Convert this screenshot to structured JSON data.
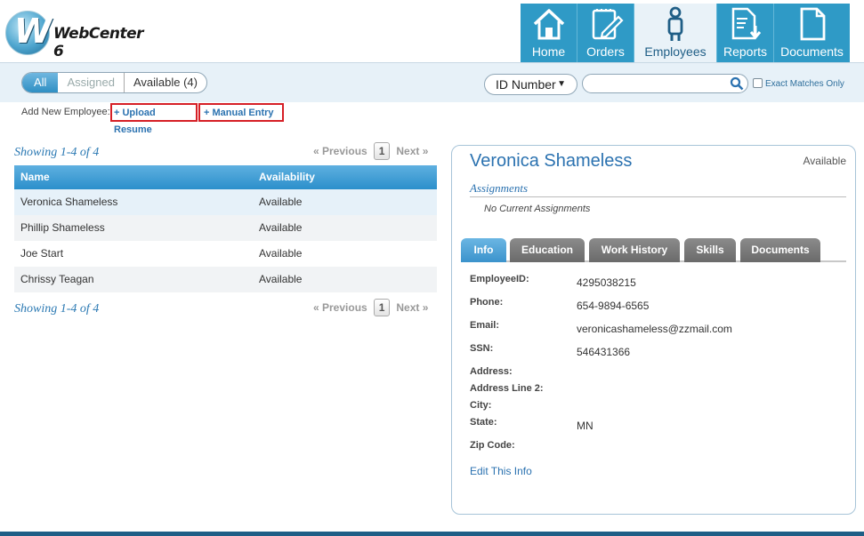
{
  "app": {
    "logo_letter": "W",
    "logo_text": "WebCenter 6"
  },
  "nav": [
    {
      "label": "Home",
      "icon": "home-icon"
    },
    {
      "label": "Orders",
      "icon": "clipboard-pencil-icon"
    },
    {
      "label": "Employees",
      "icon": "person-icon",
      "active": true
    },
    {
      "label": "Reports",
      "icon": "report-download-icon"
    },
    {
      "label": "Documents",
      "icon": "document-icon"
    }
  ],
  "filter": {
    "all": "All",
    "assigned": "Assigned",
    "available": "Available (4)",
    "id_select": "ID Number",
    "search_value": "",
    "exact_label": "Exact Matches Only"
  },
  "add": {
    "label": "Add New Employee:",
    "upload": "+ Upload Resume",
    "manual": "+ Manual Entry"
  },
  "list": {
    "showing": "Showing 1-4 of 4",
    "prev": "« Previous",
    "page": "1",
    "next": "Next »",
    "headers": {
      "name": "Name",
      "availability": "Availability"
    },
    "rows": [
      {
        "name": "Veronica Shameless",
        "availability": "Available"
      },
      {
        "name": "Phillip Shameless",
        "availability": "Available"
      },
      {
        "name": "Joe Start",
        "availability": "Available"
      },
      {
        "name": "Chrissy Teagan",
        "availability": "Available"
      }
    ]
  },
  "detail": {
    "name": "Veronica Shameless",
    "status": "Available",
    "assignments_title": "Assignments",
    "no_assignments": "No Current Assignments",
    "tabs": [
      "Info",
      "Education",
      "Work History",
      "Skills",
      "Documents"
    ],
    "fields": {
      "employee_id": {
        "label": "EmployeeID:",
        "value": "4295038215"
      },
      "phone": {
        "label": "Phone:",
        "value": "654-9894-6565"
      },
      "email": {
        "label": "Email:",
        "value": "veronicashameless@zzmail.com"
      },
      "ssn": {
        "label": "SSN:",
        "value": "546431366"
      },
      "address": {
        "label": "Address:",
        "value": ""
      },
      "address2": {
        "label": "Address Line 2:",
        "value": ""
      },
      "city": {
        "label": "City:",
        "value": ""
      },
      "state": {
        "label": "State:",
        "value": "MN"
      },
      "zip": {
        "label": "Zip Code:",
        "value": ""
      }
    },
    "edit": "Edit This Info"
  },
  "colors": {
    "accent": "#2f9ac6",
    "link": "#2b72b0",
    "highlight_border": "#d61f26"
  }
}
